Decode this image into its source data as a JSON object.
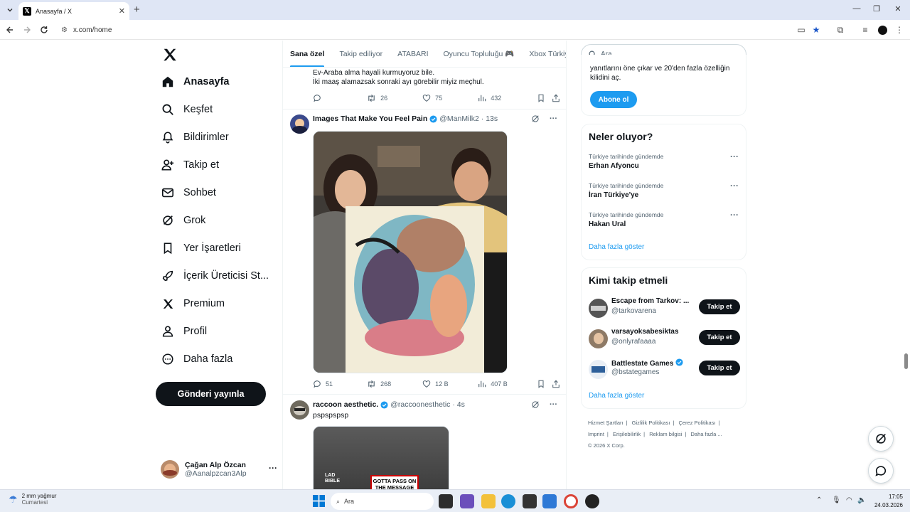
{
  "browser": {
    "tab_title": "Anasayfa / X",
    "url": "x.com/home"
  },
  "nav": {
    "items": [
      {
        "label": "Anasayfa",
        "icon": "home-icon"
      },
      {
        "label": "Keşfet",
        "icon": "search-icon"
      },
      {
        "label": "Bildirimler",
        "icon": "bell-icon"
      },
      {
        "label": "Takip et",
        "icon": "person-add-icon"
      },
      {
        "label": "Sohbet",
        "icon": "mail-icon"
      },
      {
        "label": "Grok",
        "icon": "grok-icon"
      },
      {
        "label": "Yer İşaretleri",
        "icon": "bookmark-icon"
      },
      {
        "label": "İçerik Üreticisi St...",
        "icon": "rocket-icon"
      },
      {
        "label": "Premium",
        "icon": "x-logo-icon"
      },
      {
        "label": "Profil",
        "icon": "person-icon"
      },
      {
        "label": "Daha fazla",
        "icon": "more-circle-icon"
      }
    ],
    "post_button": "Gönderi yayınla",
    "account": {
      "name": "Çağan Alp Özcan",
      "handle": "@Aanalpzcan3Alp"
    }
  },
  "feed": {
    "tabs": [
      "Sana özel",
      "Takip ediliyor",
      "ATABARI",
      "Oyuncu Topluluğu 🎮",
      "Xbox Türkiy"
    ],
    "prev_tweet": {
      "lines": [
        "Ev-Araba alma hayali kurmuyoruz bile.",
        "İki maaş alamazsak sonraki ayı görebilir miyiz meçhul."
      ],
      "retweets": "26",
      "likes": "75",
      "views": "432"
    },
    "tweets": [
      {
        "name": "Images That Make You Feel Pain",
        "handle": "@ManMilk2",
        "time": "13s",
        "replies": "51",
        "retweets": "268",
        "likes": "12 B",
        "views": "407 B"
      },
      {
        "name": "raccoon aesthetic.",
        "handle": "@raccoonesthetic",
        "time": "4s",
        "text": "pspspspsp",
        "media_text_1": "LAD BIBLE",
        "media_text_2": "GOTTA PASS ON THE MESSAGE"
      }
    ]
  },
  "sidebar": {
    "search_placeholder": "Ara",
    "premium_card": {
      "text": "yanıtlarını öne çıkar ve 20'den fazla özelliğin kilidini aç.",
      "button": "Abone ol"
    },
    "trends": {
      "title": "Neler oluyor?",
      "items": [
        {
          "category": "Türkiye tarihinde gündemde",
          "name": "Erhan Afyoncu"
        },
        {
          "category": "Türkiye tarihinde gündemde",
          "name": "İran Türkiye'ye"
        },
        {
          "category": "Türkiye tarihinde gündemde",
          "name": "Hakan Ural"
        }
      ],
      "show_more": "Daha fazla göster"
    },
    "who_to_follow": {
      "title": "Kimi takip etmeli",
      "items": [
        {
          "name": "Escape from Tarkov: ...",
          "handle": "@tarkovarena",
          "button": "Takip et"
        },
        {
          "name": "varsayoksabesiktas",
          "handle": "@onlyrafaaaa",
          "button": "Takip et"
        },
        {
          "name": "Battlestate Games",
          "handle": "@bstategames",
          "button": "Takip et"
        }
      ],
      "show_more": "Daha fazla göster"
    },
    "footer": {
      "links": [
        "Hizmet Şartları",
        "Gizlilik Politikası",
        "Çerez Politikası",
        "Imprint",
        "Erişilebilirlik",
        "Reklam bilgisi",
        "Daha fazla ..."
      ],
      "copyright": "© 2026 X Corp."
    }
  },
  "taskbar": {
    "weather_temp": "2 mm yağmur",
    "weather_day": "Cumartesi",
    "search": "Ara",
    "time": "17:05",
    "date": "24.03.2026"
  },
  "colors": {
    "accent": "#1d9bf0",
    "text": "#0f1419",
    "muted": "#536471"
  }
}
